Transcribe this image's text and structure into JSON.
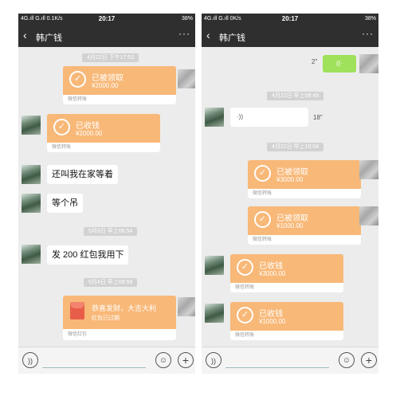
{
  "left": {
    "status": {
      "net": "4G.ıll G.ıll 0.1K/s",
      "time": "20:17",
      "battery": "38%"
    },
    "nav": {
      "back_icon": "‹",
      "title": "韩广钱",
      "more_icon": "···"
    },
    "timestamps": [
      "4月22日 下午17:53",
      "5月3日 早上06:54",
      "5月4日 早上09:58"
    ],
    "transfers": [
      {
        "title": "已被领取",
        "amount": "¥2000.00",
        "footer": "微信转账"
      },
      {
        "title": "已收钱",
        "amount": "¥2000.00",
        "footer": "微信转账"
      }
    ],
    "texts": [
      "还叫我在家等着",
      "等个吊",
      "发 200 红包我用下"
    ],
    "red_packet": {
      "title": "恭喜发财，大吉大利",
      "sub": "红包已过期",
      "footer": "微信红包"
    },
    "input": {
      "voice_icon": "))",
      "emoji_icon": "☺",
      "plus_icon": "+"
    }
  },
  "right": {
    "status": {
      "net": "4G.ıll G.ıll 0K/s",
      "time": "20:17",
      "battery": "38%"
    },
    "nav": {
      "back_icon": "‹",
      "title": "韩广钱",
      "more_icon": "···"
    },
    "voice_self": {
      "duration": "2\"",
      "icon": "((·"
    },
    "timestamps": [
      "4月22日 早上09:49",
      "4月22日 早上10:04"
    ],
    "voice_other": {
      "duration": "18\"",
      "icon": "·))"
    },
    "transfers": [
      {
        "title": "已被领取",
        "amount": "¥3000.00",
        "footer": "微信转账"
      },
      {
        "title": "已被领取",
        "amount": "¥1000.00",
        "footer": "微信转账"
      },
      {
        "title": "已收钱",
        "amount": "¥3000.00",
        "footer": "微信转账"
      },
      {
        "title": "已收钱",
        "amount": "¥1000.00",
        "footer": "微信转账"
      }
    ],
    "input": {
      "voice_icon": "))",
      "emoji_icon": "☺",
      "plus_icon": "+"
    }
  },
  "colors": {
    "transfer": "#f8b878",
    "voice_self": "#9fe15a",
    "navbar": "#2f2f2f",
    "chat_bg": "#ececec"
  }
}
